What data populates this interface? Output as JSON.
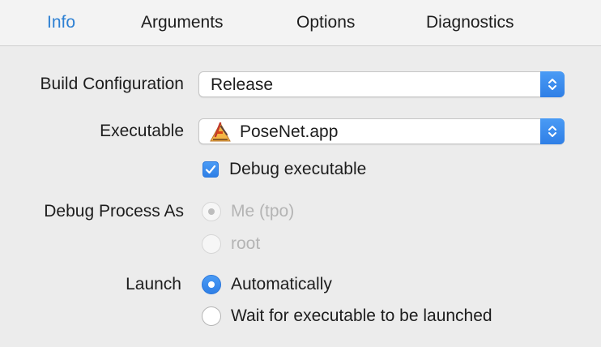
{
  "tabs": [
    {
      "label": "Info",
      "active": true
    },
    {
      "label": "Arguments",
      "active": false
    },
    {
      "label": "Options",
      "active": false
    },
    {
      "label": "Diagnostics",
      "active": false
    }
  ],
  "build_configuration": {
    "label": "Build Configuration",
    "value": "Release"
  },
  "executable": {
    "label": "Executable",
    "value": "PoseNet.app",
    "icon": "app-icon"
  },
  "debug_executable": {
    "label": "Debug executable",
    "checked": true
  },
  "debug_process_as": {
    "label": "Debug Process As",
    "options": [
      {
        "label": "Me (tpo)",
        "selected": true,
        "enabled": false
      },
      {
        "label": "root",
        "selected": false,
        "enabled": false
      }
    ]
  },
  "launch": {
    "label": "Launch",
    "options": [
      {
        "label": "Automatically",
        "selected": true,
        "enabled": true
      },
      {
        "label": "Wait for executable to be launched",
        "selected": false,
        "enabled": true
      }
    ]
  },
  "colors": {
    "accent": "#2d80d3",
    "control_blue": "#3b8cee",
    "disabled_text": "#b4b4b4",
    "background": "#ececec"
  }
}
